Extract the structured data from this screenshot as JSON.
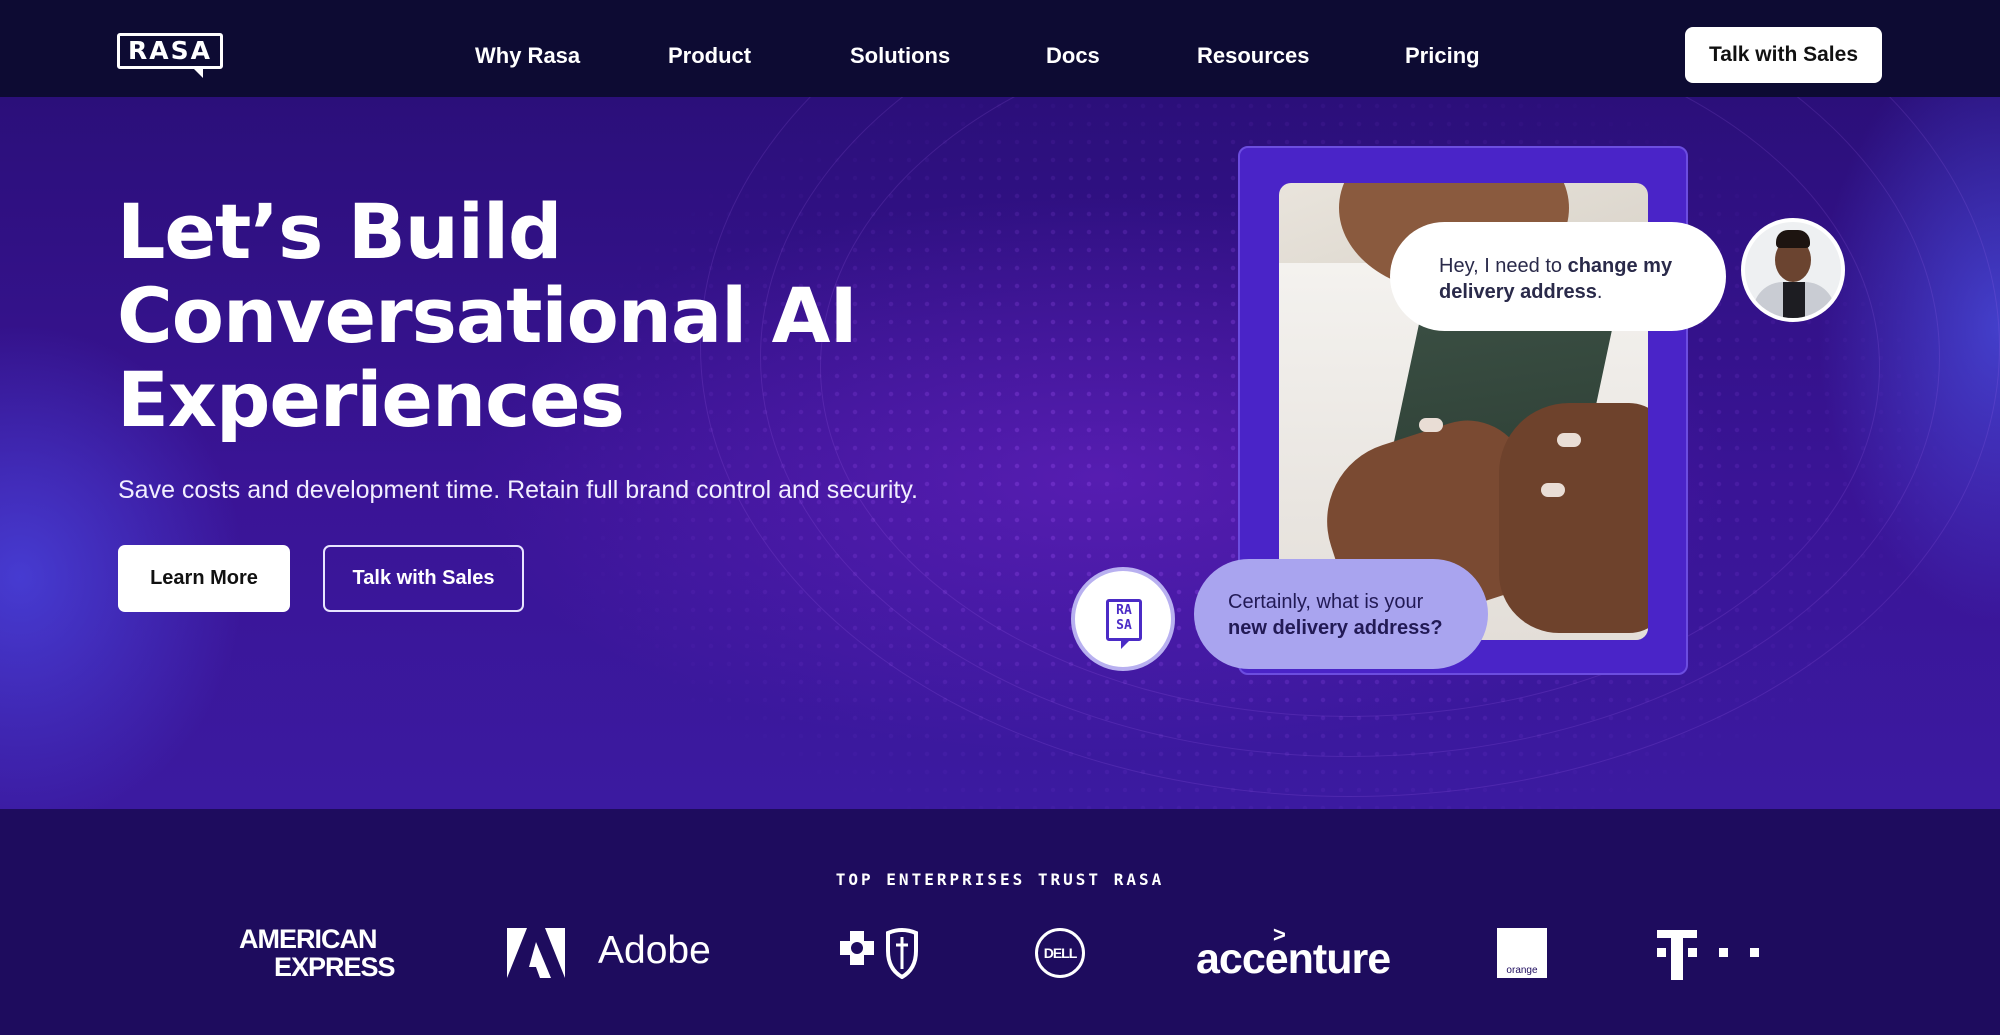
{
  "brand": {
    "logo_text": "RASA"
  },
  "nav": {
    "links": [
      "Why Rasa",
      "Product",
      "Solutions",
      "Docs",
      "Resources",
      "Pricing"
    ],
    "cta": "Talk with Sales"
  },
  "hero": {
    "headline": [
      "Let’s Build",
      "Conversational AI",
      "Experiences"
    ],
    "subhead": "Save costs and development time. Retain full brand control and security.",
    "primary_button": "Learn More",
    "secondary_button": "Talk with Sales"
  },
  "chat": {
    "user_message": {
      "plain_1": "Hey, I need to ",
      "bold": "change my delivery address",
      "plain_2": "."
    },
    "bot_message": {
      "plain": "Certainly, what is your ",
      "bold": "new delivery address?"
    },
    "bot_logo_line1": "RA",
    "bot_logo_line2": "SA"
  },
  "trust": {
    "title": "TOP ENTERPRISES TRUST RASA",
    "logos": {
      "amex_line1": "AMERICAN",
      "amex_line2": "EXPRESS",
      "adobe": "Adobe",
      "dell": "DELL",
      "accenture": "accenture",
      "orange": "orange"
    }
  },
  "colors": {
    "nav_bg": "#0d0b33",
    "hero_bg": "#3a1496",
    "trust_bg": "#1e0c5e",
    "bot_bubble": "#a9a4ef",
    "frame": "#4a24c8"
  }
}
